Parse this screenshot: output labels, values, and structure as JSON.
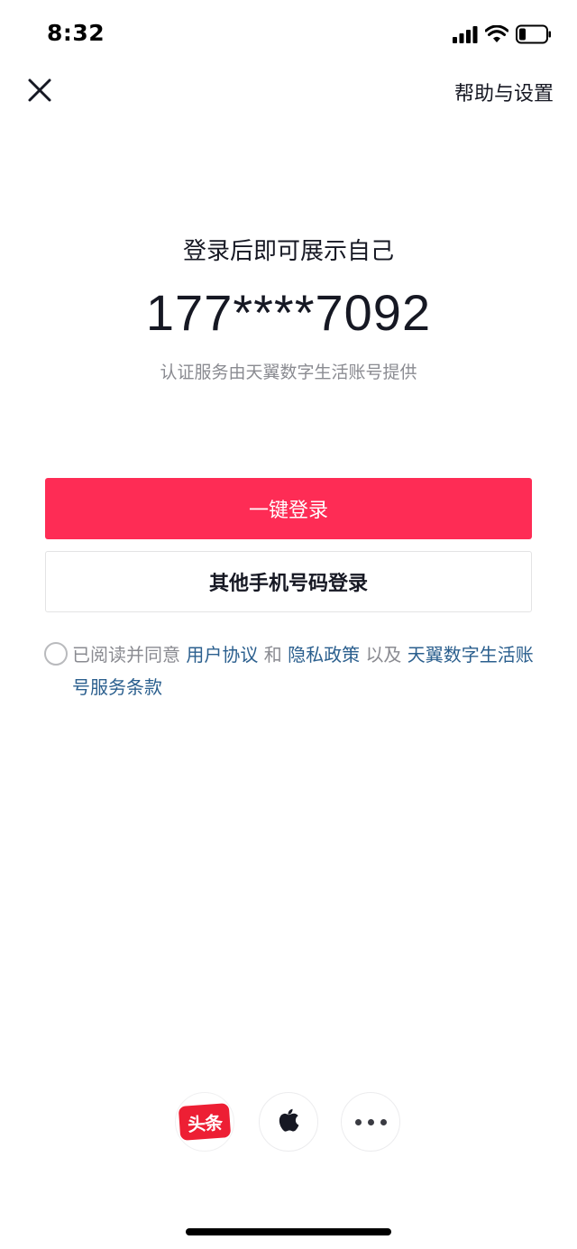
{
  "status_bar": {
    "time": "8:32",
    "signal_icon": "signal-bars-icon",
    "wifi_icon": "wifi-icon",
    "battery_icon": "battery-low-icon"
  },
  "top_bar": {
    "close_icon": "close-icon",
    "help_settings_label": "帮助与设置"
  },
  "header": {
    "headline": "登录后即可展示自己",
    "phone_number": "177****7092",
    "provider_note": "认证服务由天翼数字生活账号提供"
  },
  "buttons": {
    "one_click_login": "一键登录",
    "other_phone_login": "其他手机号码登录"
  },
  "agreement": {
    "prefix": "已阅读并同意",
    "user_agreement": "用户协议",
    "and": "和",
    "privacy_policy": "隐私政策",
    "as_well_as": "以及",
    "tianyi_terms": "天翼数字生活账号服务条款"
  },
  "third_party": {
    "toutiao_label": "头条",
    "apple_icon": "apple-icon",
    "more_icon": "more-dots-icon"
  },
  "colors": {
    "primary": "#fe2c55",
    "link": "#2b5f8e",
    "muted": "#8a8b91",
    "toutiao_red": "#ed1f34"
  }
}
